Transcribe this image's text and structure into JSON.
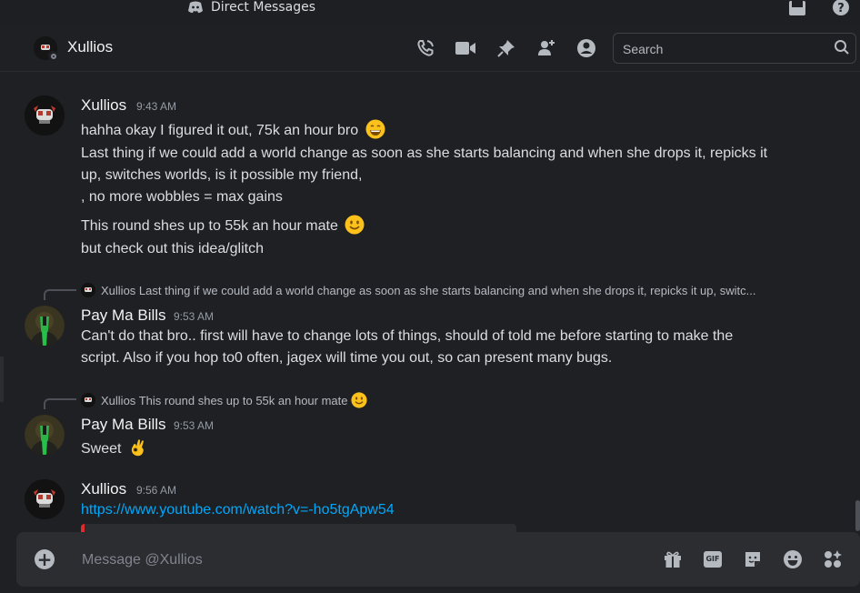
{
  "titlebar": {
    "app_title": "Direct Messages",
    "app_icon": "discord-icon",
    "inbox_icon": "inbox-icon",
    "help_icon": "help-icon"
  },
  "header": {
    "username": "Xullios",
    "status": "offline",
    "icons": [
      "phone-call-icon",
      "video-call-icon",
      "pin-icon",
      "add-friends-icon",
      "user-profile-icon"
    ],
    "search": {
      "placeholder": "Search"
    }
  },
  "messages": [
    {
      "author": "Xullios",
      "time": "9:43 AM",
      "lines": [
        "hahha okay I figured it out, 75k an hour bro",
        "Last thing if we could add a world change as soon as she starts balancing and when she drops it, repicks it",
        "up, switches worlds, is it possible my friend,",
        ", no more wobbles = max gains",
        "This round shes up to 55k an hour mate",
        "but check out this idea/glitch"
      ],
      "emojis": [
        "grinning-emoji",
        "smiling-emoji"
      ]
    },
    {
      "reply_to": {
        "author": "Xullios",
        "text": "Last thing if we could add a world change as soon as she starts balancing and when she drops it, repicks it up, switc..."
      },
      "author": "Pay Ma Bills",
      "time": "9:53 AM",
      "lines": [
        "Can't do that bro.. first will have to change lots of things, should of told me before starting to make the",
        "script. Also if you hop to0 often, jagex will time you out, so can present many bugs."
      ]
    },
    {
      "reply_to": {
        "author": "Xullios",
        "text": "This round shes up to 55k an hour mate"
      },
      "author": "Pay Ma Bills",
      "time": "9:53 AM",
      "lines": [
        "Sweet"
      ],
      "emojis": [
        "ok-hand-emoji"
      ]
    },
    {
      "author": "Xullios",
      "time": "9:56 AM",
      "link": "https://www.youtube.com/watch?v=-ho5tgApw54"
    }
  ],
  "composer": {
    "placeholder": "Message @Xullios",
    "icons": [
      "add-attachment-icon",
      "gift-icon",
      "gif-icon",
      "sticker-icon",
      "emoji-icon",
      "apps-icon"
    ],
    "gif_label": "GIF"
  }
}
